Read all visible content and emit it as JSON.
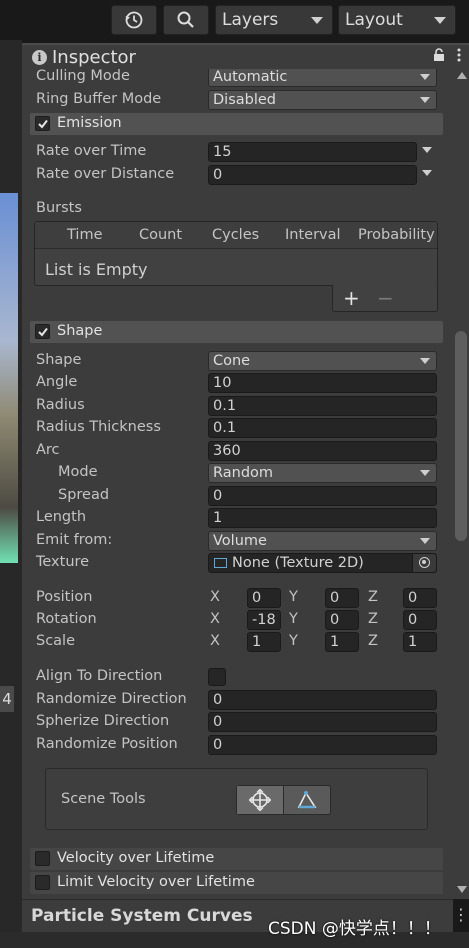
{
  "toolbar": {
    "history_icon": "history-icon",
    "search_icon": "search-icon",
    "layers_label": "Layers",
    "layout_label": "Layout"
  },
  "inspector": {
    "tab_title": "Inspector",
    "lock_icon": "lock-icon",
    "menu_icon": "kebab-menu-icon"
  },
  "main": {
    "culling_mode": {
      "label": "Culling Mode",
      "value": "Automatic"
    },
    "ring_buffer_mode": {
      "label": "Ring Buffer Mode",
      "value": "Disabled"
    }
  },
  "emission": {
    "title": "Emission",
    "enabled": true,
    "rate_over_time": {
      "label": "Rate over Time",
      "value": "15"
    },
    "rate_over_distance": {
      "label": "Rate over Distance",
      "value": "0"
    },
    "bursts": {
      "label": "Bursts",
      "columns": [
        "Time",
        "Count",
        "Cycles",
        "Interval",
        "Probability"
      ],
      "empty_text": "List is Empty",
      "add_label": "+",
      "remove_label": "−"
    }
  },
  "shape": {
    "title": "Shape",
    "enabled": true,
    "shape": {
      "label": "Shape",
      "value": "Cone"
    },
    "angle": {
      "label": "Angle",
      "value": "10"
    },
    "radius": {
      "label": "Radius",
      "value": "0.1"
    },
    "radius_thickness": {
      "label": "Radius Thickness",
      "value": "0.1"
    },
    "arc": {
      "label": "Arc",
      "value": "360"
    },
    "mode": {
      "label": "Mode",
      "value": "Random"
    },
    "spread": {
      "label": "Spread",
      "value": "0"
    },
    "length": {
      "label": "Length",
      "value": "1"
    },
    "emit_from": {
      "label": "Emit from:",
      "value": "Volume"
    },
    "texture": {
      "label": "Texture",
      "value": "None (Texture 2D)"
    },
    "axis_labels": {
      "x": "X",
      "y": "Y",
      "z": "Z"
    },
    "position": {
      "label": "Position",
      "x": "0",
      "y": "0",
      "z": "0"
    },
    "rotation": {
      "label": "Rotation",
      "x": "-18",
      "y": "0",
      "z": "0"
    },
    "scale": {
      "label": "Scale",
      "x": "1",
      "y": "1",
      "z": "1"
    },
    "align_to_direction": {
      "label": "Align To Direction",
      "checked": false
    },
    "randomize_direction": {
      "label": "Randomize Direction",
      "value": "0"
    },
    "spherize_direction": {
      "label": "Spherize Direction",
      "value": "0"
    },
    "randomize_position": {
      "label": "Randomize Position",
      "value": "0"
    },
    "scene_tools": {
      "label": "Scene Tools",
      "buttons": [
        "transform-gizmo-icon",
        "shape-edit-icon"
      ]
    }
  },
  "modules": {
    "velocity_over_lifetime": {
      "title": "Velocity over Lifetime",
      "enabled": false
    },
    "limit_velocity_over_lifetime": {
      "title": "Limit Velocity over Lifetime",
      "enabled": false
    }
  },
  "curves_panel": {
    "title": "Particle System Curves"
  },
  "left_panel": {
    "number": "4"
  },
  "watermark": "CSDN @快学点！！！",
  "colors": {
    "accent": "#5fa8d8",
    "panel": "#3c3c3c",
    "field": "#252525"
  }
}
